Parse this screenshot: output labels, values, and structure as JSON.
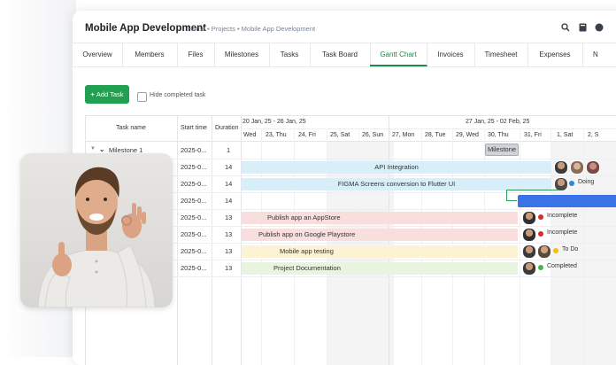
{
  "header": {
    "title": "Mobile App Development",
    "breadcrumb": "Home • Projects • Mobile App Development"
  },
  "tabs": [
    "Overview",
    "Members",
    "Files",
    "Milestones",
    "Tasks",
    "Task Board",
    "Gantt Chart",
    "Invoices",
    "Timesheet",
    "Expenses",
    "N"
  ],
  "active_tab": "Gantt Chart",
  "toolbar": {
    "add_task_label": "Add Task",
    "add_icon": "+",
    "hide_completed_label": "Hide completed task"
  },
  "table": {
    "columns": {
      "task_name": "Task name",
      "start_time": "Start time",
      "duration": "Duration"
    },
    "rows": [
      {
        "name": "Milestone 1",
        "start": "2025-0...",
        "duration": "1"
      },
      {
        "name": "",
        "start": "2025-0...",
        "duration": "14"
      },
      {
        "name": "",
        "start": "2025-0...",
        "duration": "14"
      },
      {
        "name": "",
        "start": "2025-0...",
        "duration": "14"
      },
      {
        "name": "",
        "start": "2025-0...",
        "duration": "13"
      },
      {
        "name": "",
        "start": "2025-0...",
        "duration": "13"
      },
      {
        "name": "",
        "start": "2025-0...",
        "duration": "13"
      },
      {
        "name": "",
        "start": "2025-0...",
        "duration": "13"
      }
    ]
  },
  "timeline": {
    "weeks": [
      "20 Jan, 25 - 26 Jan, 25",
      "27 Jan, 25 - 02 Feb, 25"
    ],
    "days": [
      "Wed",
      "23, Thu",
      "24, Fri",
      "25, Sat",
      "26, Sun",
      "27, Mon",
      "28, Tue",
      "29, Wed",
      "30, Thu",
      "31, Fri",
      "1, Sat",
      "2, S"
    ]
  },
  "bars": [
    {
      "label": "Milestone",
      "color": "#cfd2d6"
    },
    {
      "label": "API Integration",
      "color": "#d8eef9"
    },
    {
      "label": "FIGMA Screens conversion to Flutter UI",
      "color": "#d8eef9",
      "status": "Doing",
      "status_color": "#2b8ad8"
    },
    {
      "label": "",
      "color": "#3a73e8"
    },
    {
      "label": "Publish app an AppStore",
      "color": "#f9dede",
      "status": "Incomplete",
      "status_color": "#d32f2f"
    },
    {
      "label": "Publish app on Google Playstore",
      "color": "#f9dede",
      "status": "Incomplete",
      "status_color": "#d32f2f"
    },
    {
      "label": "Mobile app testing",
      "color": "#fbf3d4",
      "status": "To Do",
      "status_color": "#f2c200"
    },
    {
      "label": "Project Documentation",
      "color": "#e8f3e0",
      "status": "Completed",
      "status_color": "#4caf50"
    }
  ],
  "icons": {
    "search": "search-icon",
    "book": "book-icon"
  }
}
